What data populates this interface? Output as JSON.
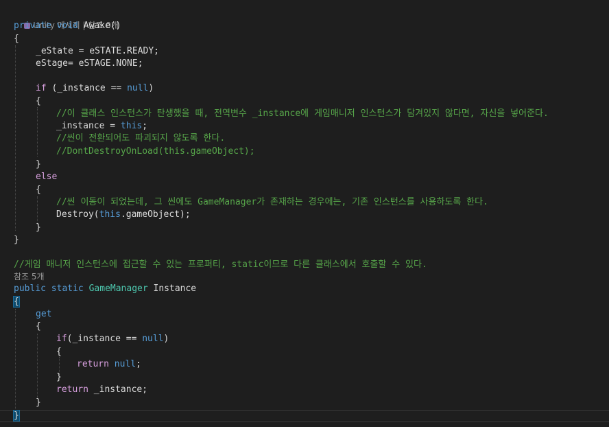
{
  "codelens": {
    "awake_refs": "Unity 메시지 | 참조 0개",
    "instance_refs": "참조 5개"
  },
  "code": {
    "l_awake_sig": [
      "private",
      " ",
      "void",
      " Awake()"
    ],
    "brace_open": "{",
    "brace_close": "}",
    "estate_line": "_eState = eSTATE.READY;",
    "estage_line": "eStage= eSTAGE.NONE;",
    "if_kw": "if",
    "if_rest_a": " (_instance == ",
    "null_kw": "null",
    "paren_close": ")",
    "comment_1": "//이 클래스 인스턴스가 탄생했을 때, 전역변수 _instance에 게임매니저 인스턴스가 담겨있지 않다면, 자신을 넣어준다.",
    "assign_a": "_instance = ",
    "this_kw": "this",
    "semicolon": ";",
    "comment_2": "//씬이 전환되어도 파괴되지 않도록 한다.",
    "comment_3": "//DontDestroyOnLoad(this.gameObject);",
    "else_kw": "else",
    "comment_4": "//씬 이동이 되었는데, 그 씬에도 GameManager가 존재하는 경우에는, 기존 인스턴스를 사용하도록 한다.",
    "destroy_a": "Destroy(",
    "destroy_b": ".gameObject);",
    "comment_5": "//게임 매니저 인스턴스에 접근할 수 있는 프로퍼티, static이므로 다른 클래스에서 호출할 수 있다.",
    "public_kw": "public",
    "static_kw": "static",
    "type_gm": "GameManager",
    "prop_name": " Instance",
    "get_kw": "get",
    "if2_rest": "(_instance == ",
    "return_kw": "return",
    "return_null_tail": ";",
    "return_inst": " _instance;",
    "space": " "
  }
}
